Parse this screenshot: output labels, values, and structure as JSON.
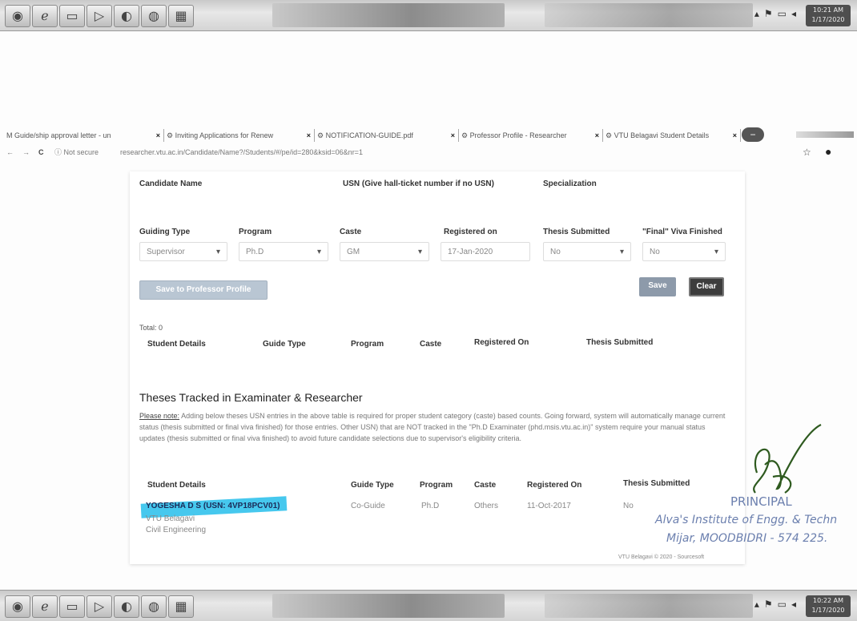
{
  "taskbar": {
    "top_clock_time": "10:21 AM",
    "top_clock_date": "1/17/2020",
    "bottom_clock_time": "10:22 AM",
    "bottom_clock_date": "1/17/2020"
  },
  "browser": {
    "tabs": [
      {
        "label": "M  Guide/ship approval letter - un",
        "close": "×"
      },
      {
        "label": "⚙  Inviting Applications for Renew",
        "close": "×"
      },
      {
        "label": "⚙  NOTIFICATION-GUIDE.pdf",
        "close": "×"
      },
      {
        "label": "⚙  Professor Profile - Researcher",
        "close": "×"
      },
      {
        "label": "⚙  VTU Belagavi Student Details",
        "close": "×"
      }
    ],
    "nav_back": "←",
    "nav_forward": "→",
    "nav_reload": "C",
    "security_label": "ⓘ Not secure",
    "url": "researcher.vtu.ac.in/Candidate/Name?/Students/#/pe/id=280&ksid=06&nr=1"
  },
  "form": {
    "candidate_name_label": "Candidate Name",
    "usn_label": "USN (Give hall-ticket number if no USN)",
    "specialization_label": "Specialization",
    "guiding_type_label": "Guiding Type",
    "program_label": "Program",
    "caste_label": "Caste",
    "registered_on_label": "Registered on",
    "thesis_submitted_label": "Thesis Submitted",
    "final_viva_label": "\"Final\" Viva Finished",
    "guiding_type_value": "Supervisor",
    "program_value": "Ph.D",
    "caste_value": "GM",
    "registered_on_value": "17-Jan-2020",
    "thesis_submitted_value": "No",
    "final_viva_value": "No",
    "caret": "▾",
    "save_to_profile_label": "Save to Professor Profile",
    "save_label": "Save",
    "clear_label": "Clear"
  },
  "table1": {
    "total_label": "Total: 0",
    "headers": [
      "Student Details",
      "Guide Type",
      "Program",
      "Caste",
      "Registered On",
      "Thesis Submitted"
    ]
  },
  "section2": {
    "title": "Theses Tracked in Examinater & Researcher",
    "note_prefix": "Please note:",
    "note_body": "Adding below theses USN entries in the above table is required for proper student category (caste) based counts. Going forward, system will automatically manage current status (thesis submitted or final viva finished) for those entries. Other USN) that are NOT tracked in the \"Ph.D Examinater (phd.msis.vtu.ac.in)\" system require your manual status updates (thesis submitted or final viva finished) to avoid future candidate selections due to supervisor's eligibility criteria.",
    "headers": [
      "Student Details",
      "Guide Type",
      "Program",
      "Caste",
      "Registered On",
      "Thesis Submitted"
    ],
    "row": {
      "student": "YOGESHA D S (USN: 4VP18PCV01)",
      "university": "VTU Belagavi",
      "department": "Civil Engineering",
      "guide_type": "Co-Guide",
      "program": "Ph.D",
      "caste": "Others",
      "registered_on": "11-Oct-2017",
      "thesis_submitted": "No"
    },
    "footer": "VTU Belagavi © 2020 - Sourcesoft"
  },
  "stamp": {
    "title": "PRINCIPAL",
    "line1": "Alva's Institute of Engg. & Techn",
    "line2": "Mijar, MOODBIDRI - 574 225."
  }
}
